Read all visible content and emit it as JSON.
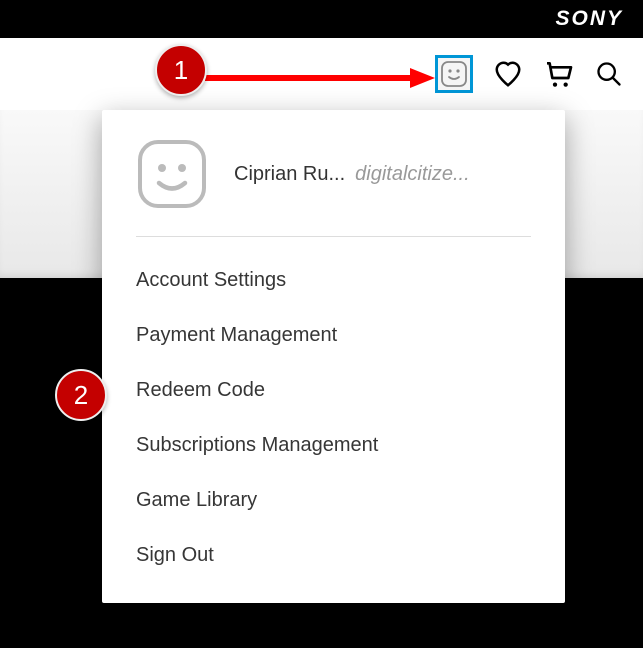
{
  "brand": {
    "sony": "SONY"
  },
  "header": {
    "avatar_alt": "profile",
    "icons": {
      "heart": "wishlist",
      "cart": "cart",
      "search": "search"
    }
  },
  "dropdown": {
    "profile": {
      "name": "Ciprian Ru...",
      "username": "digitalcitize..."
    },
    "items": [
      {
        "label": "Account Settings"
      },
      {
        "label": "Payment Management"
      },
      {
        "label": "Redeem Code"
      },
      {
        "label": "Subscriptions Management"
      },
      {
        "label": "Game Library"
      },
      {
        "label": "Sign Out"
      }
    ]
  },
  "annotations": {
    "step1": "1",
    "step2": "2"
  }
}
